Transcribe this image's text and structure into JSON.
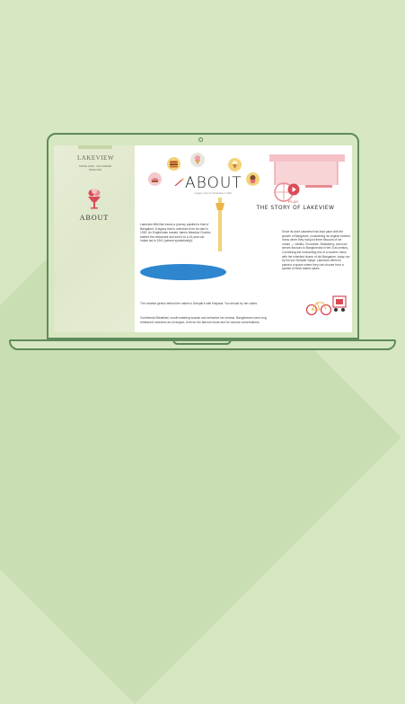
{
  "colors": {
    "background": "#d6e7c1",
    "laptop_outline": "#5f8a5a",
    "lake_blue": "#2e86cf",
    "cart_pink": "#f5c1c6",
    "accent_red": "#d94b57"
  },
  "sidebar": {
    "brand": "LAKEVIEW",
    "brand_sub": "SINCE 1930 · ICE CREAM PARLOUR",
    "nav_icon": "ice-cream-cup-icon",
    "nav_label": "ABOUT"
  },
  "main": {
    "title": "ABOUT",
    "subtitle": "a legacy since its introduction in 1930",
    "para1": "Lakeview Milk Bar traces a journey parallel to that of Bangalore. A legacy that is unbroken from its start in 1930. An Englishman named James Meadow Charles started the restaurant and sold it to a 16-year-old Indian lad in 1941 (almost symbolically)!",
    "para2": "The creative genius behind the cakes is Deepak's wife Kalpana. You should try her cakes.",
    "para3": "Continental Breakfast, mouth watering snacks and seductive ice creams. Bangloreans have long embraced Lakeview as a hangout, both for the famous foods and for various conversations.",
    "story_para": "Since its start Lakeview has kept pace with the growth of Bangalore, considering its original modest menu when they had just three flavours of ice cream — Vanilla, Chocolate, Strawberry, and now serves flavours to Bangloreans in the 21st century. Combining the enchanting mix of a modern menu with the inherited charm of old Bangalore, today run by his son Deepak Vijaya. Lakeview offers its patrons a space where they can choose from a spread of fresh baked cakes.",
    "play_label": "PLAY",
    "story_title": "THE STORY OF LAKEVIEW"
  },
  "icons": [
    "burger-icon",
    "ice-cream-icon",
    "ice-cream-cone-icon",
    "cupcake-icon",
    "pastry-icon",
    "drink-icon",
    "wand-icon",
    "cart-icon",
    "bicycle-icon"
  ]
}
